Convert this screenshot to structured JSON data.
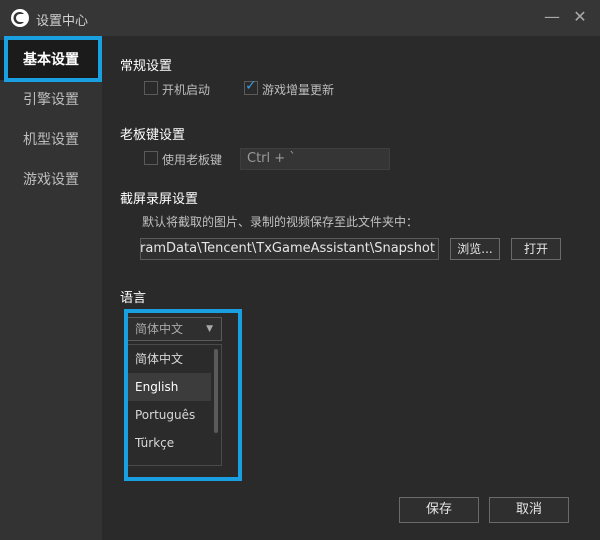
{
  "window": {
    "title": "设置中心",
    "minimize": "—",
    "close": "✕"
  },
  "sidebar": {
    "items": [
      {
        "label": "基本设置"
      },
      {
        "label": "引擎设置"
      },
      {
        "label": "机型设置"
      },
      {
        "label": "游戏设置"
      }
    ]
  },
  "general": {
    "title": "常规设置",
    "autostart_label": "开机启动",
    "autostart_checked": false,
    "incremental_label": "游戏增量更新",
    "incremental_checked": true
  },
  "bosskey": {
    "title": "老板键设置",
    "use_label": "使用老板键",
    "use_checked": false,
    "hotkey_value": "Ctrl + `"
  },
  "screenshot": {
    "title": "截屏录屏设置",
    "hint": "默认将截取的图片、录制的视频保存至此文件夹中：",
    "path": "gramData\\Tencent\\TxGameAssistant\\Snapshot",
    "browse_label": "浏览...",
    "open_label": "打开"
  },
  "language": {
    "title": "语言",
    "selected": "简体中文",
    "options": [
      "简体中文",
      "English",
      "Português",
      "Türkçe"
    ],
    "hovered_index": 1
  },
  "footer": {
    "save_label": "保存",
    "cancel_label": "取消"
  },
  "colors": {
    "accent": "#1aa0e0",
    "check": "#3a9bdc"
  }
}
